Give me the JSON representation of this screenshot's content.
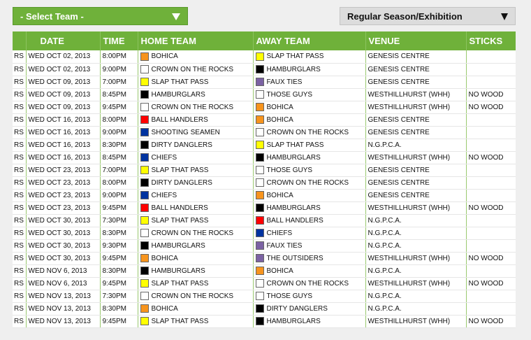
{
  "team_select": {
    "label": "- Select Team -"
  },
  "season_select": {
    "label": "Regular Season/Exhibition"
  },
  "table": {
    "headers": [
      "",
      "DATE",
      "TIME",
      "HOME TEAM",
      "AWAY TEAM",
      "VENUE",
      "STICKS"
    ],
    "rows": [
      {
        "type": "RS",
        "date": "WED OCT 02, 2013",
        "time": "8:00PM",
        "home": "BOHICA",
        "home_color": "#f7941d",
        "away": "SLAP THAT PASS",
        "away_color": "#ffff00",
        "venue": "GENESIS CENTRE",
        "sticks": ""
      },
      {
        "type": "RS",
        "date": "WED OCT 02, 2013",
        "time": "9:00PM",
        "home": "CROWN ON THE ROCKS",
        "home_color": "#ffffff",
        "away": "HAMBURGLARS",
        "away_color": "#000000",
        "venue": "GENESIS CENTRE",
        "sticks": ""
      },
      {
        "type": "RS",
        "date": "WED OCT 09, 2013",
        "time": "7:00PM",
        "home": "SLAP THAT PASS",
        "home_color": "#ffff00",
        "away": "FAUX TIES",
        "away_color": "#7b62a3",
        "venue": "GENESIS CENTRE",
        "sticks": ""
      },
      {
        "type": "RS",
        "date": "WED OCT 09, 2013",
        "time": "8:45PM",
        "home": "HAMBURGLARS",
        "home_color": "#000000",
        "away": "THOSE GUYS",
        "away_color": "#ffffff",
        "venue": "WESTHILLHURST (WHH)",
        "sticks": "NO WOOD"
      },
      {
        "type": "RS",
        "date": "WED OCT 09, 2013",
        "time": "9:45PM",
        "home": "CROWN ON THE ROCKS",
        "home_color": "#ffffff",
        "away": "BOHICA",
        "away_color": "#f7941d",
        "venue": "WESTHILLHURST (WHH)",
        "sticks": "NO WOOD"
      },
      {
        "type": "RS",
        "date": "WED OCT 16, 2013",
        "time": "8:00PM",
        "home": "BALL HANDLERS",
        "home_color": "#ff0000",
        "away": "BOHICA",
        "away_color": "#f7941d",
        "venue": "GENESIS CENTRE",
        "sticks": ""
      },
      {
        "type": "RS",
        "date": "WED OCT 16, 2013",
        "time": "9:00PM",
        "home": "SHOOTING SEAMEN",
        "home_color": "#0033a0",
        "away": "CROWN ON THE ROCKS",
        "away_color": "#ffffff",
        "venue": "GENESIS CENTRE",
        "sticks": ""
      },
      {
        "type": "RS",
        "date": "WED OCT 16, 2013",
        "time": "8:30PM",
        "home": "DIRTY DANGLERS",
        "home_color": "#000000",
        "away": "SLAP THAT PASS",
        "away_color": "#ffff00",
        "venue": "N.G.P.C.A.",
        "sticks": ""
      },
      {
        "type": "RS",
        "date": "WED OCT 16, 2013",
        "time": "8:45PM",
        "home": "CHIEFS",
        "home_color": "#0033a0",
        "away": "HAMBURGLARS",
        "away_color": "#000000",
        "venue": "WESTHILLHURST (WHH)",
        "sticks": "NO WOOD"
      },
      {
        "type": "RS",
        "date": "WED OCT 23, 2013",
        "time": "7:00PM",
        "home": "SLAP THAT PASS",
        "home_color": "#ffff00",
        "away": "THOSE GUYS",
        "away_color": "#ffffff",
        "venue": "GENESIS CENTRE",
        "sticks": ""
      },
      {
        "type": "RS",
        "date": "WED OCT 23, 2013",
        "time": "8:00PM",
        "home": "DIRTY DANGLERS",
        "home_color": "#000000",
        "away": "CROWN ON THE ROCKS",
        "away_color": "#ffffff",
        "venue": "GENESIS CENTRE",
        "sticks": ""
      },
      {
        "type": "RS",
        "date": "WED OCT 23, 2013",
        "time": "9:00PM",
        "home": "CHIEFS",
        "home_color": "#0033a0",
        "away": "BOHICA",
        "away_color": "#f7941d",
        "venue": "GENESIS CENTRE",
        "sticks": ""
      },
      {
        "type": "RS",
        "date": "WED OCT 23, 2013",
        "time": "9:45PM",
        "home": "BALL HANDLERS",
        "home_color": "#ff0000",
        "away": "HAMBURGLARS",
        "away_color": "#000000",
        "venue": "WESTHILLHURST (WHH)",
        "sticks": "NO WOOD"
      },
      {
        "type": "RS",
        "date": "WED OCT 30, 2013",
        "time": "7:30PM",
        "home": "SLAP THAT PASS",
        "home_color": "#ffff00",
        "away": "BALL HANDLERS",
        "away_color": "#ff0000",
        "venue": "N.G.P.C.A.",
        "sticks": ""
      },
      {
        "type": "RS",
        "date": "WED OCT 30, 2013",
        "time": "8:30PM",
        "home": "CROWN ON THE ROCKS",
        "home_color": "#ffffff",
        "away": "CHIEFS",
        "away_color": "#0033a0",
        "venue": "N.G.P.C.A.",
        "sticks": ""
      },
      {
        "type": "RS",
        "date": "WED OCT 30, 2013",
        "time": "9:30PM",
        "home": "HAMBURGLARS",
        "home_color": "#000000",
        "away": "FAUX TIES",
        "away_color": "#7b62a3",
        "venue": "N.G.P.C.A.",
        "sticks": ""
      },
      {
        "type": "RS",
        "date": "WED OCT 30, 2013",
        "time": "9:45PM",
        "home": "BOHICA",
        "home_color": "#f7941d",
        "away": "THE OUTSIDERS",
        "away_color": "#7b62a3",
        "venue": "WESTHILLHURST (WHH)",
        "sticks": "NO WOOD"
      },
      {
        "type": "RS",
        "date": "WED NOV 6, 2013",
        "time": "8:30PM",
        "home": "HAMBURGLARS",
        "home_color": "#000000",
        "away": "BOHICA",
        "away_color": "#f7941d",
        "venue": "N.G.P.C.A.",
        "sticks": ""
      },
      {
        "type": "RS",
        "date": "WED NOV 6, 2013",
        "time": "9:45PM",
        "home": "SLAP THAT PASS",
        "home_color": "#ffff00",
        "away": "CROWN ON THE ROCKS",
        "away_color": "#ffffff",
        "venue": "WESTHILLHURST (WHH)",
        "sticks": "NO WOOD"
      },
      {
        "type": "RS",
        "date": "WED NOV 13, 2013",
        "time": "7:30PM",
        "home": "CROWN ON THE ROCKS",
        "home_color": "#ffffff",
        "away": "THOSE GUYS",
        "away_color": "#ffffff",
        "venue": "N.G.P.C.A.",
        "sticks": ""
      },
      {
        "type": "RS",
        "date": "WED NOV 13, 2013",
        "time": "8:30PM",
        "home": "BOHICA",
        "home_color": "#f7941d",
        "away": "DIRTY DANGLERS",
        "away_color": "#000000",
        "venue": "N.G.P.C.A.",
        "sticks": ""
      },
      {
        "type": "RS",
        "date": "WED NOV 13, 2013",
        "time": "9:45PM",
        "home": "SLAP THAT PASS",
        "home_color": "#ffff00",
        "away": "HAMBURGLARS",
        "away_color": "#000000",
        "venue": "WESTHILLHURST (WHH)",
        "sticks": "NO WOOD"
      }
    ]
  }
}
